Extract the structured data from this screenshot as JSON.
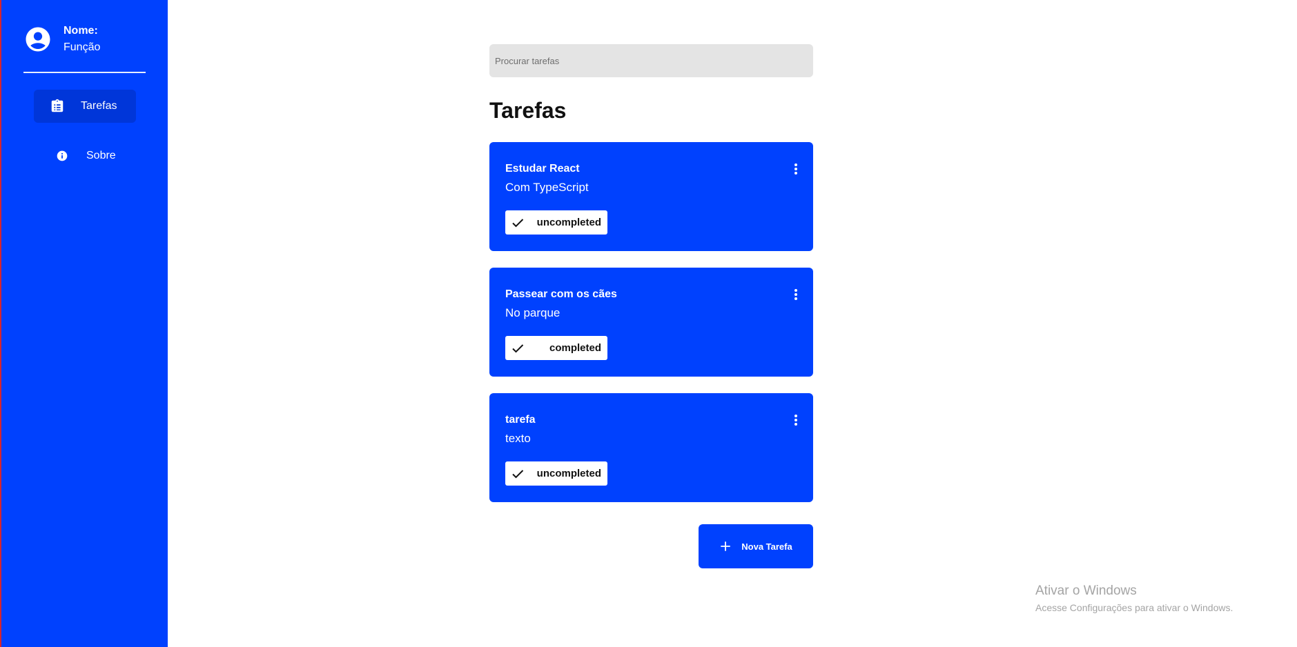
{
  "colors": {
    "brand": "#0041fe",
    "nav_active": "#0036d9",
    "search_bg": "#e4e4e4",
    "status_bg": "#ffffff"
  },
  "sidebar": {
    "profile": {
      "avatar_icon": "account-circle-icon",
      "name_label": "Nome:",
      "role_label": "Função"
    },
    "items": [
      {
        "label": "Tarefas",
        "icon": "clipboard-list-icon",
        "active": true
      },
      {
        "label": "Sobre",
        "icon": "info-icon",
        "active": false
      }
    ]
  },
  "search": {
    "placeholder": "Procurar tarefas",
    "value": ""
  },
  "main": {
    "title": "Tarefas",
    "tasks": [
      {
        "title": "Estudar React",
        "description": "Com TypeScript",
        "status": "uncompleted",
        "menu_icon": "more-vertical-icon",
        "status_icon": "check-icon"
      },
      {
        "title": "Passear com os cães",
        "description": "No parque",
        "status": "completed",
        "menu_icon": "more-vertical-icon",
        "status_icon": "check-icon"
      },
      {
        "title": "tarefa",
        "description": "texto",
        "status": "uncompleted",
        "menu_icon": "more-vertical-icon",
        "status_icon": "check-icon"
      }
    ],
    "new_task": {
      "label": "Nova Tarefa",
      "icon": "plus-icon"
    }
  },
  "watermark": {
    "title": "Ativar o Windows",
    "subtitle": "Acesse Configurações para ativar o Windows."
  }
}
